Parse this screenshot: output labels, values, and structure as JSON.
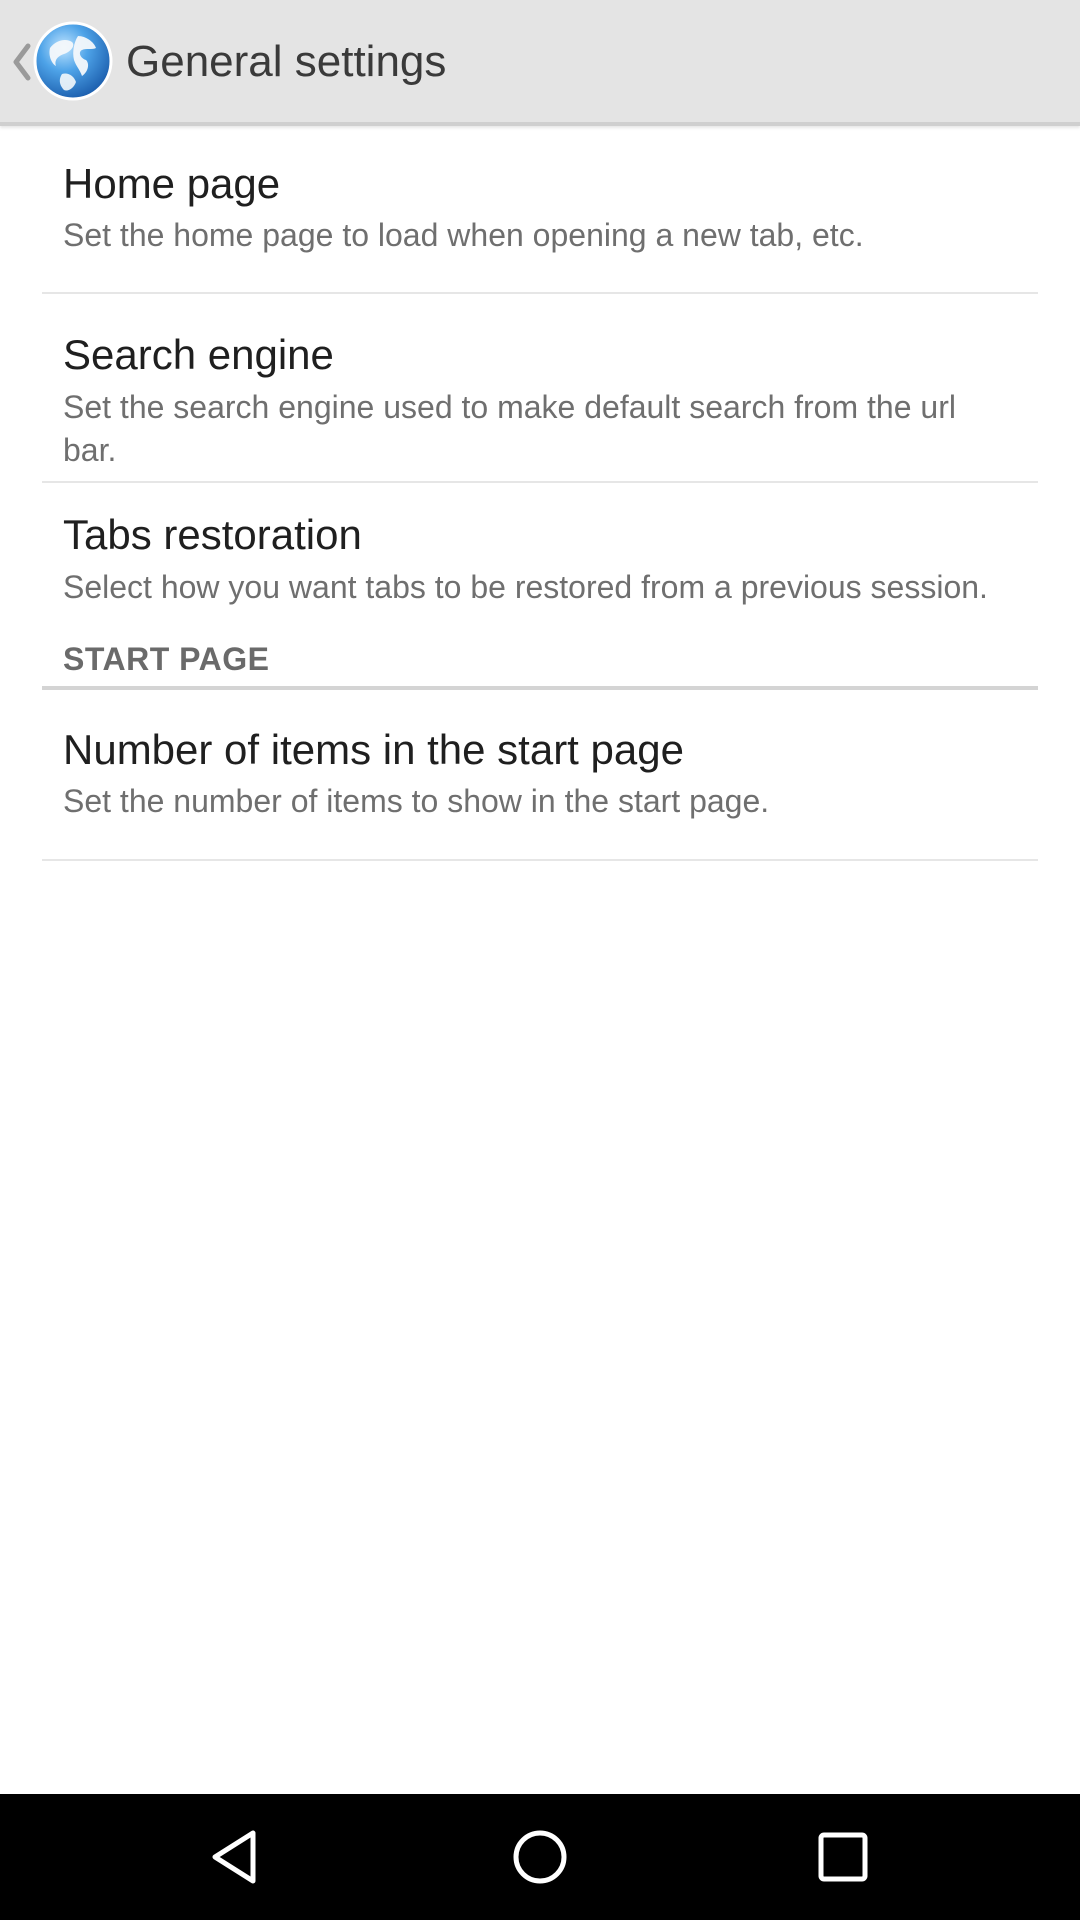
{
  "action_bar": {
    "title": "General settings",
    "up_icon": "chevron-left-icon",
    "app_icon": "globe-icon"
  },
  "preferences": [
    {
      "title": "Home page",
      "summary": "Set the home page to load when opening a new tab, etc."
    },
    {
      "title": "Search engine",
      "summary": "Set the search engine used to make default search from the url bar."
    },
    {
      "title": "Tabs restoration",
      "summary": "Select how you want tabs to be restored from a previous session."
    }
  ],
  "start_page_category": {
    "title": "START PAGE",
    "items": [
      {
        "title": "Number of items in the start page",
        "summary": "Set the number of items to show in the start page."
      }
    ]
  },
  "nav_bar": {
    "back_icon": "triangle-back-icon",
    "home_icon": "circle-home-icon",
    "recents_icon": "square-recents-icon"
  },
  "colors": {
    "action_bar_bg": "#e4e4e4",
    "title_text": "#1f1f1f",
    "summary_text": "#6f6f6f",
    "nav_bar_bg": "#000000"
  }
}
